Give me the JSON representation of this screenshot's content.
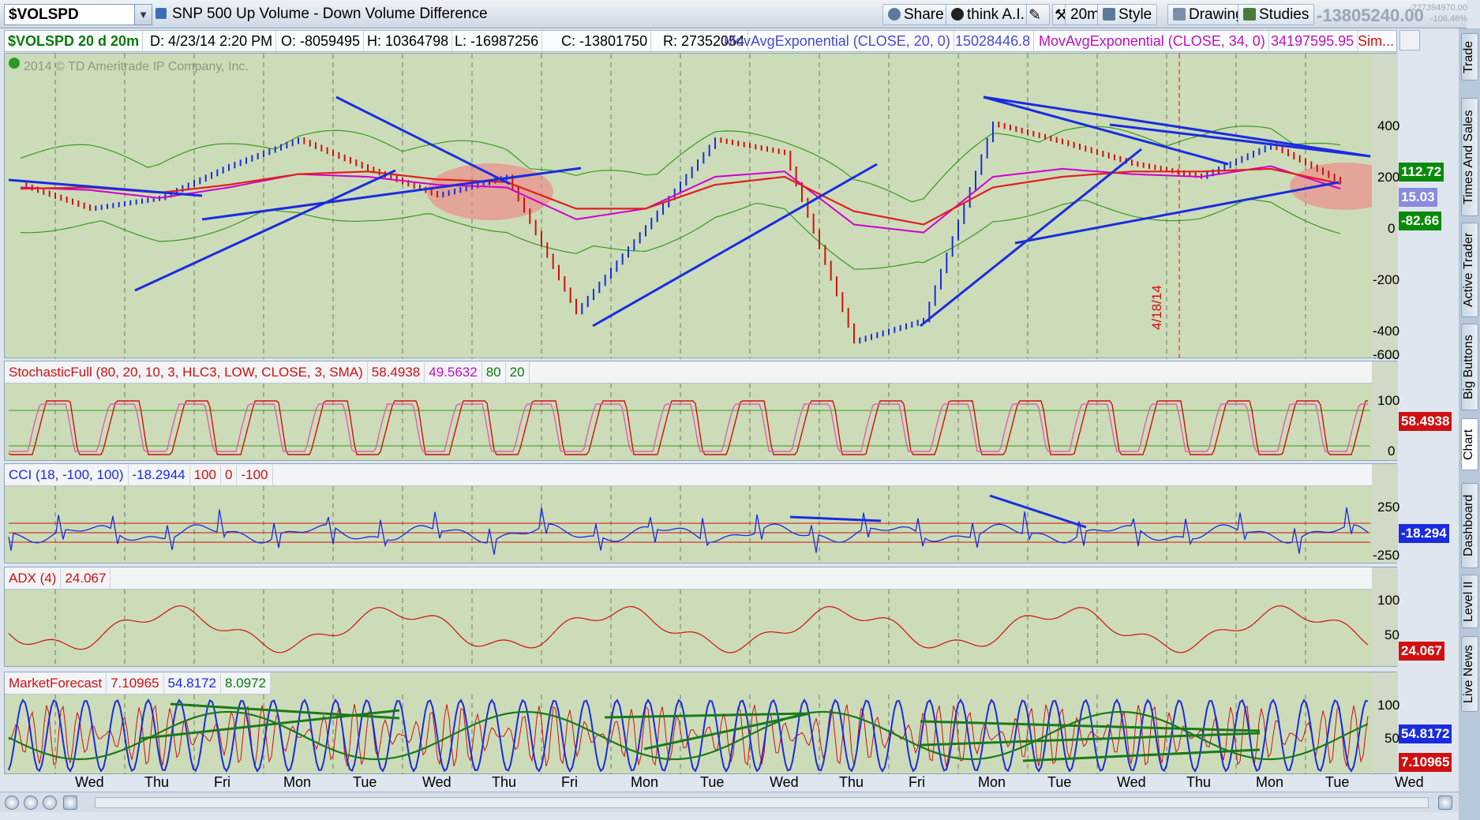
{
  "toolbar": {
    "symbol": "$VOLSPD",
    "description": "SNP 500 Up Volume - Down Volume Difference",
    "share": "Share",
    "think": "think A.I.",
    "interval": "20m",
    "style": "Style",
    "drawings": "Drawings",
    "studies": "Studies",
    "last_value": "-13805240.00",
    "net_change": "-227394970.00",
    "pct_change": "-106.46%"
  },
  "infobar": {
    "symbol_period": "$VOLSPD 20 d 20m",
    "date": "D: 4/23/14 2:20 PM",
    "open": "O: -8059495",
    "high": "H: 10364798",
    "low": "L: -16987256",
    "close": "C: -13801750",
    "range": "R: 27352054",
    "ema20_label": "MovAvgExponential (CLOSE, 20, 0)",
    "ema20_value": "15028446.8",
    "ema34_label": "MovAvgExponential (CLOSE, 34, 0)",
    "ema34_value": "34197595.95",
    "sim": "Sim..."
  },
  "watermark": "2014 © TD Ameritrade IP Company, Inc.",
  "colors": {
    "chart_bg": "#ccdcb8",
    "trendline": "#1a2ce0",
    "ema20": "#d000d0",
    "ema34": "#e02020",
    "bollinger": "#3a9a20",
    "up_bar": "#1a2ce0",
    "down_bar": "#d01010",
    "highlight": "#f08080"
  },
  "main_panel": {
    "y_ticks": [
      "400",
      "200",
      "0",
      "-200",
      "-400",
      "-600"
    ],
    "tags": {
      "upper": "112.72",
      "mid": "15.03",
      "lower": "-82.66"
    },
    "date_marker": "4/18/14"
  },
  "stochastic": {
    "title": "StochasticFull (80, 20, 10, 3, HLC3, LOW, CLOSE, 3, SMA)",
    "k": "58.4938",
    "d": "49.5632",
    "ob": "80",
    "os": "20",
    "y_ticks": [
      "100",
      "0"
    ],
    "tag": "58.4938"
  },
  "cci": {
    "title": "CCI (18, -100, 100)",
    "value": "-18.2944",
    "upper": "100",
    "zero": "0",
    "lower": "-100",
    "y_ticks": [
      "250",
      "-250"
    ],
    "tag": "-18.294"
  },
  "adx": {
    "title": "ADX (4)",
    "value": "24.067",
    "y_ticks": [
      "100",
      "50"
    ],
    "tag": "24.067"
  },
  "market_forecast": {
    "title": "MarketForecast",
    "v1": "7.10965",
    "v2": "54.8172",
    "v3": "8.0972",
    "y_ticks": [
      "100",
      "50"
    ],
    "tag_blue": "54.8172",
    "tag_red": "7.10965"
  },
  "x_axis": [
    "Wed",
    "Thu",
    "Fri",
    "Mon",
    "Tue",
    "Wed",
    "Thu",
    "Fri",
    "Mon",
    "Tue",
    "Wed",
    "Thu",
    "Fri",
    "Mon",
    "Tue",
    "Wed",
    "Thu",
    "Mon",
    "Tue",
    "Wed"
  ],
  "sidebar_tabs": [
    "Trade",
    "Times And Sales",
    "Active Trader",
    "Big Buttons",
    "Chart",
    "Dashboard",
    "Level II",
    "Live News"
  ],
  "chart_data": {
    "type": "line",
    "title": "SNP 500 Up Volume - Down Volume Difference",
    "xlabel": "",
    "ylabel": "",
    "ylim": [
      -600,
      500
    ],
    "categories": [
      "Wed",
      "Thu",
      "Fri",
      "Mon",
      "Tue",
      "Wed",
      "Thu",
      "Fri",
      "Mon",
      "Tue",
      "Wed",
      "Thu",
      "Fri",
      "Mon",
      "Tue",
      "Wed",
      "Thu",
      "Mon",
      "Tue",
      "Wed"
    ],
    "series": [
      {
        "name": "$VOLSPD",
        "values": [
          30,
          -60,
          -20,
          100,
          200,
          90,
          -10,
          60,
          -450,
          -130,
          200,
          150,
          -560,
          -480,
          260,
          190,
          110,
          60,
          180,
          40
        ]
      },
      {
        "name": "MovAvgExponential (CLOSE, 20, 0)",
        "values": [
          20,
          10,
          -20,
          20,
          70,
          60,
          30,
          20,
          -100,
          -60,
          60,
          80,
          -120,
          -150,
          60,
          90,
          70,
          60,
          100,
          15
        ]
      },
      {
        "name": "MovAvgExponential (CLOSE, 34, 0)",
        "values": [
          15,
          20,
          0,
          30,
          70,
          80,
          50,
          40,
          -60,
          -60,
          30,
          60,
          -70,
          -120,
          20,
          60,
          80,
          80,
          90,
          34
        ]
      }
    ],
    "grid": true
  }
}
